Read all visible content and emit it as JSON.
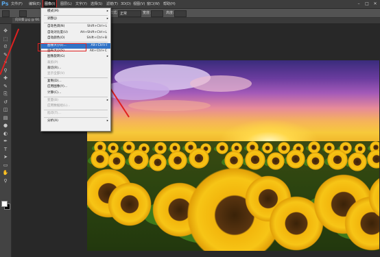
{
  "app": {
    "logo": "Ps"
  },
  "menubar": {
    "items": [
      {
        "label": "文件(F)",
        "active": false
      },
      {
        "label": "编辑(E)",
        "active": false
      },
      {
        "label": "图像(I)",
        "active": true
      },
      {
        "label": "图层(L)",
        "active": false
      },
      {
        "label": "文字(Y)",
        "active": false
      },
      {
        "label": "选择(S)",
        "active": false
      },
      {
        "label": "滤镜(T)",
        "active": false
      },
      {
        "label": "3D(D)",
        "active": false
      },
      {
        "label": "视图(V)",
        "active": false
      },
      {
        "label": "窗口(W)",
        "active": false
      },
      {
        "label": "帮助(H)",
        "active": false
      }
    ],
    "window_controls": [
      "–",
      "□",
      "✕"
    ]
  },
  "options_bar": {
    "style_label": "样式:",
    "style_value": "正常",
    "width_label": "宽度:",
    "height_label": "高度:"
  },
  "document_tab": {
    "label": "向日葵.jpg @ 66.7%(RGB/8)"
  },
  "toolbar": {
    "tools": [
      "move-tool-icon",
      "marquee-tool-icon",
      "lasso-tool-icon",
      "quick-select-tool-icon",
      "crop-tool-icon",
      "eyedropper-tool-icon",
      "healing-brush-icon",
      "brush-tool-icon",
      "clone-stamp-icon",
      "history-brush-icon",
      "eraser-tool-icon",
      "gradient-tool-icon",
      "blur-tool-icon",
      "dodge-tool-icon",
      "pen-tool-icon",
      "type-tool-icon",
      "path-select-icon",
      "shape-tool-icon",
      "hand-tool-icon",
      "zoom-tool-icon"
    ],
    "glyphs": [
      "✥",
      "⬚",
      "ᘓ",
      "✎",
      "⌗",
      "⚲",
      "✚",
      "✎",
      "⎘",
      "↺",
      "◫",
      "▤",
      "●",
      "◐",
      "✒",
      "T",
      "➤",
      "▭",
      "✋",
      "⚲"
    ],
    "fg_color": "#ffffff",
    "bg_color": "#000000"
  },
  "image_menu": {
    "items": [
      {
        "label": "模式(M)",
        "shortcut": "",
        "submenu": true,
        "disabled": false,
        "highlighted": false
      },
      {
        "sep": true
      },
      {
        "label": "调整(J)",
        "shortcut": "",
        "submenu": true,
        "disabled": false,
        "highlighted": false
      },
      {
        "sep": true
      },
      {
        "label": "自动色调(N)",
        "shortcut": "Shift+Ctrl+L",
        "submenu": false,
        "disabled": false,
        "highlighted": false
      },
      {
        "label": "自动对比度(U)",
        "shortcut": "Alt+Shift+Ctrl+L",
        "submenu": false,
        "disabled": false,
        "highlighted": false
      },
      {
        "label": "自动颜色(O)",
        "shortcut": "Shift+Ctrl+B",
        "submenu": false,
        "disabled": false,
        "highlighted": false
      },
      {
        "sep": true
      },
      {
        "label": "图像大小(I)...",
        "shortcut": "Alt+Ctrl+I",
        "submenu": false,
        "disabled": false,
        "highlighted": true
      },
      {
        "label": "画布大小(S)...",
        "shortcut": "Alt+Ctrl+C",
        "submenu": false,
        "disabled": false,
        "highlighted": false
      },
      {
        "label": "图像旋转(G)",
        "shortcut": "",
        "submenu": true,
        "disabled": false,
        "highlighted": false
      },
      {
        "label": "裁剪(P)",
        "shortcut": "",
        "submenu": false,
        "disabled": true,
        "highlighted": false
      },
      {
        "label": "裁切(R)...",
        "shortcut": "",
        "submenu": false,
        "disabled": false,
        "highlighted": false
      },
      {
        "label": "显示全部(V)",
        "shortcut": "",
        "submenu": false,
        "disabled": true,
        "highlighted": false
      },
      {
        "sep": true
      },
      {
        "label": "复制(D)...",
        "shortcut": "",
        "submenu": false,
        "disabled": false,
        "highlighted": false
      },
      {
        "label": "应用图像(Y)...",
        "shortcut": "",
        "submenu": false,
        "disabled": false,
        "highlighted": false
      },
      {
        "label": "计算(C)...",
        "shortcut": "",
        "submenu": false,
        "disabled": false,
        "highlighted": false
      },
      {
        "sep": true
      },
      {
        "label": "变量(B)",
        "shortcut": "",
        "submenu": true,
        "disabled": true,
        "highlighted": false
      },
      {
        "label": "应用数据组(L)...",
        "shortcut": "",
        "submenu": false,
        "disabled": true,
        "highlighted": false
      },
      {
        "sep": true
      },
      {
        "label": "陷印(T)...",
        "shortcut": "",
        "submenu": false,
        "disabled": true,
        "highlighted": false
      },
      {
        "sep": true
      },
      {
        "label": "分析(A)",
        "shortcut": "",
        "submenu": true,
        "disabled": false,
        "highlighted": false
      }
    ]
  },
  "colors": {
    "highlight": "#3173c6",
    "annotation": "#e02020",
    "menubar_bg": "#3d3d3d"
  }
}
